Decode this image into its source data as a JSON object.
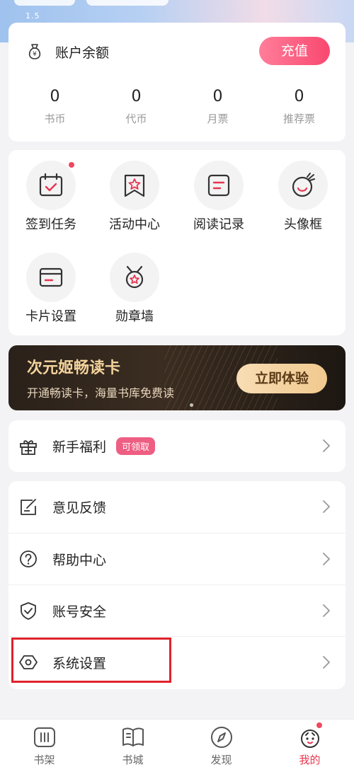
{
  "status": {
    "signal_text": "1.5"
  },
  "balance": {
    "title": "账户余额",
    "recharge_label": "充值",
    "stats": [
      {
        "value": "0",
        "label": "书币"
      },
      {
        "value": "0",
        "label": "代币"
      },
      {
        "value": "0",
        "label": "月票"
      },
      {
        "value": "0",
        "label": "推荐票"
      }
    ]
  },
  "features": [
    {
      "label": "签到任务",
      "icon": "calendar-check-icon",
      "dot": true
    },
    {
      "label": "活动中心",
      "icon": "star-ribbon-icon"
    },
    {
      "label": "阅读记录",
      "icon": "document-icon"
    },
    {
      "label": "头像框",
      "icon": "smiley-avatar-icon"
    },
    {
      "label": "卡片设置",
      "icon": "card-icon"
    },
    {
      "label": "勋章墙",
      "icon": "medal-icon"
    }
  ],
  "promo": {
    "title": "次元姬畅读卡",
    "subtitle": "开通畅读卡，海量书库免费读",
    "button": "立即体验"
  },
  "newbie": {
    "label": "新手福利",
    "badge": "可领取"
  },
  "menu": [
    {
      "label": "意见反馈",
      "icon": "feedback-icon"
    },
    {
      "label": "帮助中心",
      "icon": "help-icon"
    },
    {
      "label": "账号安全",
      "icon": "shield-icon"
    },
    {
      "label": "系统设置",
      "icon": "settings-hexagon-icon"
    }
  ],
  "nav": [
    {
      "label": "书架",
      "icon": "bookshelf-icon"
    },
    {
      "label": "书城",
      "icon": "book-icon"
    },
    {
      "label": "发现",
      "icon": "compass-icon"
    },
    {
      "label": "我的",
      "icon": "profile-icon",
      "active": true
    }
  ],
  "colors": {
    "accent": "#f9486f",
    "gold": "#f3d39c",
    "highlight": "#e0222c"
  }
}
